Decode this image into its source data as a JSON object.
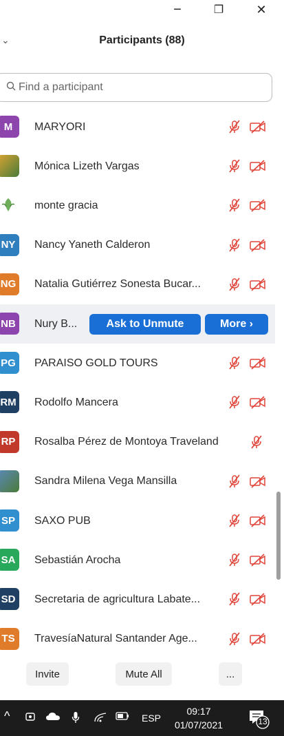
{
  "window": {
    "minimize_icon": "−",
    "restore_icon": "❐",
    "close_icon": "✕"
  },
  "header": {
    "title": "Participants (88)"
  },
  "search": {
    "placeholder": "Find a participant"
  },
  "participants": [
    {
      "initials": "M",
      "name": "MARYORI",
      "color": "#8e44ad",
      "avatar": "initials"
    },
    {
      "initials": "",
      "name": "Mónica Lizeth Vargas",
      "color": "#d9a431",
      "avatar": "photo"
    },
    {
      "initials": "",
      "name": "monte gracia",
      "color": "#ffffff",
      "avatar": "logo"
    },
    {
      "initials": "NY",
      "name": "Nancy Yaneth Calderon",
      "color": "#2f7fbf",
      "avatar": "initials"
    },
    {
      "initials": "NG",
      "name": "Natalia Gutiérrez Sonesta Bucar...",
      "color": "#e07b2a",
      "avatar": "initials"
    },
    {
      "initials": "NB",
      "name": "Nury B...",
      "color": "#8e44ad",
      "avatar": "initials"
    },
    {
      "initials": "PG",
      "name": "PARAISO GOLD TOURS",
      "color": "#2f8fcf",
      "avatar": "initials"
    },
    {
      "initials": "RM",
      "name": "Rodolfo Mancera",
      "color": "#1f3f63",
      "avatar": "initials"
    },
    {
      "initials": "RP",
      "name": "Rosalba Pérez de Montoya Traveland",
      "color": "#c0392b",
      "avatar": "initials"
    },
    {
      "initials": "",
      "name": "Sandra Milena Vega Mansilla",
      "color": "#5b8ab8",
      "avatar": "photo"
    },
    {
      "initials": "SP",
      "name": "SAXO PUB",
      "color": "#2f8fcf",
      "avatar": "initials"
    },
    {
      "initials": "SA",
      "name": "Sebastián Arocha",
      "color": "#27a85a",
      "avatar": "initials"
    },
    {
      "initials": "SD",
      "name": "Secretaria de agricultura Labate...",
      "color": "#1f3f63",
      "avatar": "initials"
    },
    {
      "initials": "TS",
      "name": "TravesíaNatural Santander Age...",
      "color": "#e07b2a",
      "avatar": "initials"
    }
  ],
  "hover_actions": {
    "ask_to_unmute": "Ask to Unmute",
    "more": "More ›"
  },
  "footer": {
    "invite": "Invite",
    "mute_all": "Mute All",
    "more": "..."
  },
  "taskbar": {
    "language": "ESP",
    "time": "09:17",
    "date": "01/07/2021",
    "notifications": "13"
  },
  "colors": {
    "accent": "#1a6fd6",
    "muted_icon": "#e0453a"
  }
}
